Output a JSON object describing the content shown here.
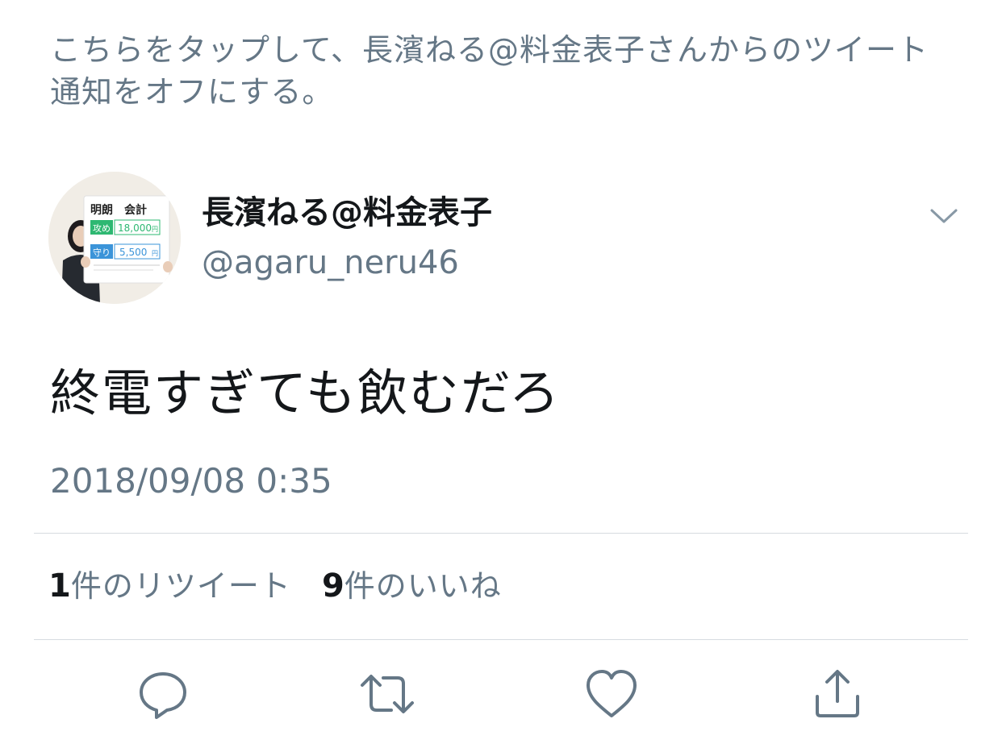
{
  "notice": {
    "text": "こちらをタップして、長濱ねる@料金表子さんからのツイート通知をオフにする。"
  },
  "author": {
    "display_name": "長濱ねる@料金表子",
    "handle": "@agaru_neru46",
    "avatar_sign": {
      "title": "明朗　会計",
      "row1_tag": "攻め",
      "row1_price": "18,000",
      "row1_unit": "円",
      "row2_tag": "守り",
      "row2_price": "5,500",
      "row2_unit": "円"
    }
  },
  "tweet": {
    "text": "終電すぎても飲むだろ",
    "timestamp": "2018/09/08 0:35"
  },
  "stats": {
    "retweets_count": "1",
    "retweets_label": "件のリツイート",
    "likes_count": "9",
    "likes_label": "件のいいね"
  },
  "icons": {
    "menu": "chevron-down-icon",
    "reply": "reply-icon",
    "retweet": "retweet-icon",
    "like": "heart-icon",
    "share": "share-icon"
  },
  "colors": {
    "secondary_text": "#657786",
    "primary_text": "#14171a",
    "divider": "#d6dbe0",
    "sign_green": "#2eb872",
    "sign_blue": "#3b94d9"
  }
}
